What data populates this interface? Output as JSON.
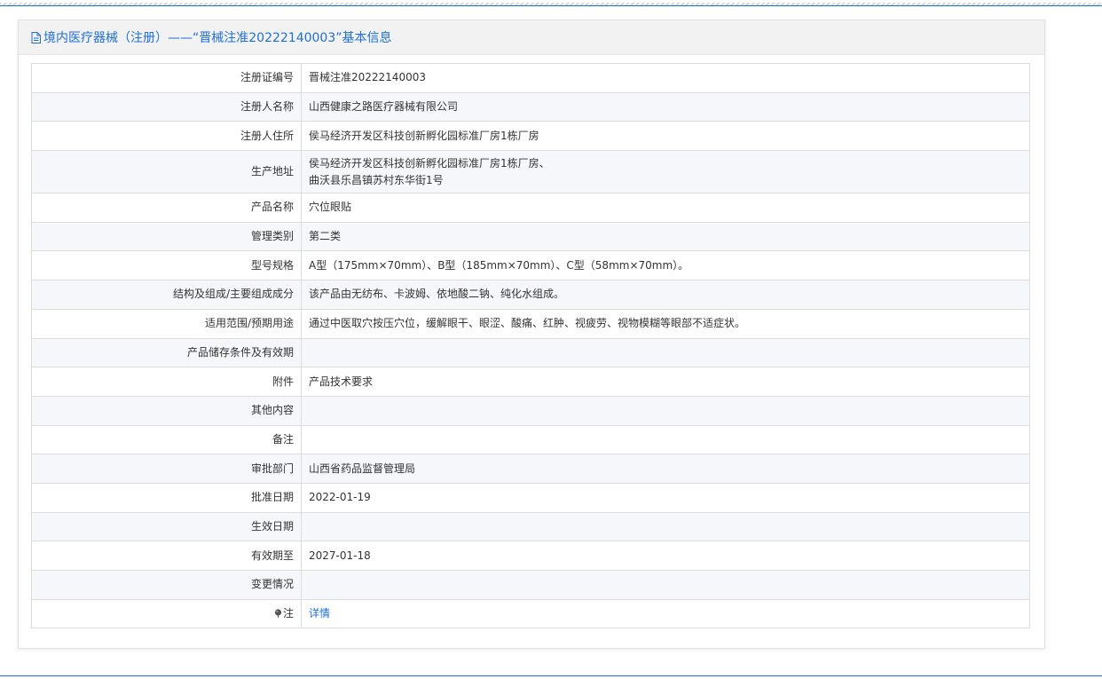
{
  "header": {
    "title": "境内医疗器械（注册）——“晋械注准20222140003”基本信息"
  },
  "rows": [
    {
      "label": "注册证编号",
      "value": "晋械注准20222140003"
    },
    {
      "label": "注册人名称",
      "value": "山西健康之路医疗器械有限公司"
    },
    {
      "label": "注册人住所",
      "value": "侯马经济开发区科技创新孵化园标准厂房1栋厂房"
    },
    {
      "label": "生产地址",
      "value_line1": "侯马经济开发区科技创新孵化园标准厂房1栋厂房、",
      "value_line2": "曲沃县乐昌镇苏村东华街1号"
    },
    {
      "label": "产品名称",
      "value": "穴位眼贴"
    },
    {
      "label": "管理类别",
      "value": "第二类"
    },
    {
      "label": "型号规格",
      "value": "A型（175mm×70mm）、B型（185mm×70mm）、C型（58mm×70mm）。"
    },
    {
      "label": "结构及组成/主要组成成分",
      "value": "该产品由无纺布、卡波姆、依地酸二钠、纯化水组成。"
    },
    {
      "label": "适用范围/预期用途",
      "value": "通过中医取穴按压穴位，缓解眼干、眼涩、酸痛、红肿、视疲劳、视物模糊等眼部不适症状。"
    },
    {
      "label": "产品储存条件及有效期",
      "value": ""
    },
    {
      "label": "附件",
      "value": "产品技术要求"
    },
    {
      "label": "其他内容",
      "value": ""
    },
    {
      "label": "备注",
      "value": ""
    },
    {
      "label": "审批部门",
      "value": "山西省药品监督管理局"
    },
    {
      "label": "批准日期",
      "value": "2022-01-19"
    },
    {
      "label": "生效日期",
      "value": ""
    },
    {
      "label": "有效期至",
      "value": "2027-01-18"
    },
    {
      "label": "变更情况",
      "value": ""
    },
    {
      "label": "注",
      "value": "详情"
    }
  ],
  "icons": {
    "header_icon": "document-icon",
    "note_icon": "pin-icon"
  },
  "colors": {
    "accent": "#1e6fd9",
    "header_bg": "#f2f2f2",
    "stripe_bg": "#f5f7fa"
  }
}
